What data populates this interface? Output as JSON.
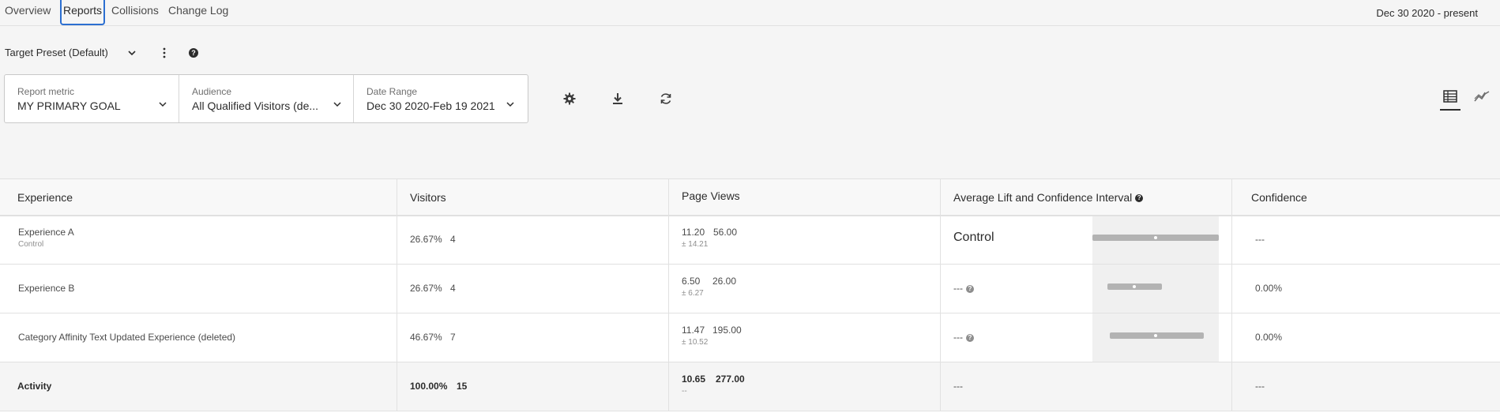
{
  "tabs": [
    {
      "label": "Overview"
    },
    {
      "label": "Reports",
      "active": true
    },
    {
      "label": "Collisions"
    },
    {
      "label": "Change Log"
    }
  ],
  "date_range_top": "Dec 30 2020 - present",
  "preset": {
    "label": "Target Preset (Default)"
  },
  "filters": {
    "report_metric": {
      "label": "Report metric",
      "value": "MY PRIMARY GOAL"
    },
    "audience": {
      "label": "Audience",
      "value": "All Qualified Visitors (de..."
    },
    "date_range": {
      "label": "Date Range",
      "value": "Dec 30 2020-Feb 19 2021"
    }
  },
  "icons": {
    "settings": "gear-icon",
    "download": "download-icon",
    "refresh": "refresh-icon",
    "table_view": "table-view-icon",
    "graph_view": "graph-view-icon"
  },
  "table": {
    "headers": {
      "experience": "Experience",
      "visitors": "Visitors",
      "page_views": "Page Views",
      "lift": "Average Lift and Confidence Interval",
      "confidence": "Confidence"
    },
    "rows": [
      {
        "name": "Experience A",
        "sub": "Control",
        "visitors_pct": "26.67%",
        "visitors_count": "4",
        "pv_avg": "11.20",
        "pv_total": "56.00",
        "pv_ci": "± 14.21",
        "lift": "Control",
        "confidence": "---",
        "ci": {
          "low": 0.0,
          "high": 1.0,
          "mean": 0.5
        }
      },
      {
        "name": "Experience B",
        "sub": "",
        "visitors_pct": "26.67%",
        "visitors_count": "4",
        "pv_avg": "6.50",
        "pv_total": "26.00",
        "pv_ci": "± 6.27",
        "lift": "---",
        "confidence": "0.00%",
        "ci": {
          "low": 0.12,
          "high": 0.55,
          "mean": 0.33
        }
      },
      {
        "name": "Category Affinity Text Updated Experience (deleted)",
        "sub": "",
        "visitors_pct": "46.67%",
        "visitors_count": "7",
        "pv_avg": "11.47",
        "pv_total": "195.00",
        "pv_ci": "± 10.52",
        "lift": "---",
        "confidence": "0.00%",
        "ci": {
          "low": 0.14,
          "high": 0.88,
          "mean": 0.5
        }
      }
    ],
    "summary": {
      "name": "Activity",
      "visitors_pct": "100.00%",
      "visitors_count": "15",
      "pv_avg": "10.65",
      "pv_total": "277.00",
      "pv_ci": "--",
      "lift": "---",
      "confidence": "---"
    }
  }
}
